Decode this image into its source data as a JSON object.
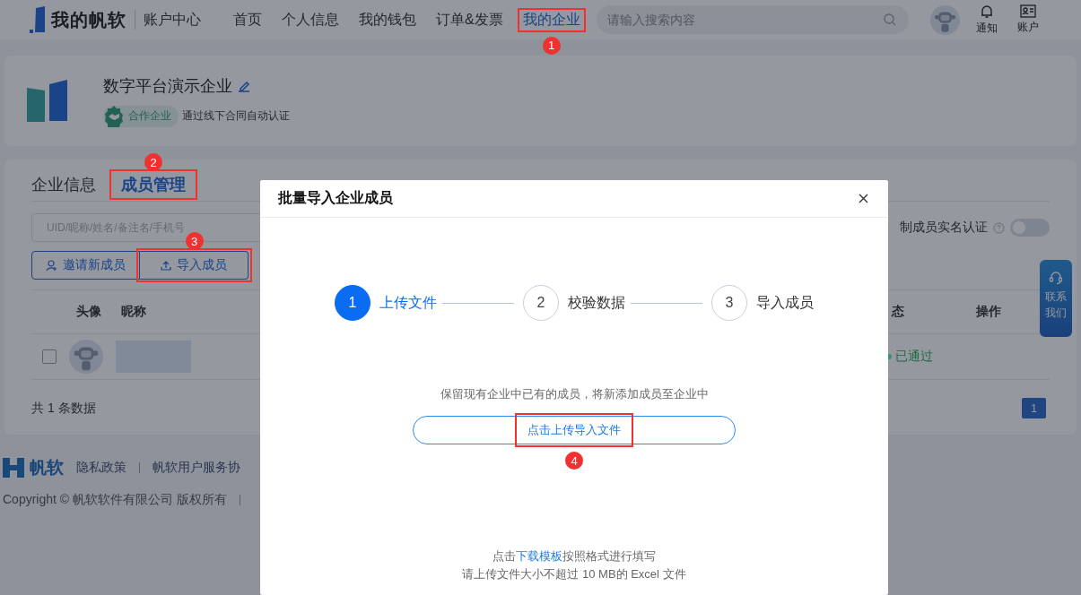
{
  "header": {
    "logo_text": "我的帆软",
    "section": "账户中心",
    "nav": [
      {
        "label": "首页",
        "selected": false
      },
      {
        "label": "个人信息",
        "selected": false
      },
      {
        "label": "我的钱包",
        "selected": false
      },
      {
        "label": "订单&发票",
        "selected": false
      },
      {
        "label": "我的企业",
        "selected": true,
        "callout": "1"
      }
    ],
    "search": {
      "placeholder": "请输入搜索内容"
    },
    "actions": [
      {
        "label": "通知",
        "kind": "bell"
      },
      {
        "label": "账户",
        "kind": "card"
      }
    ]
  },
  "company": {
    "name": "数字平台演示企业",
    "badge": "合作企业",
    "note": "通过线下合同自动认证"
  },
  "members": {
    "tabs": [
      {
        "label": "企业信息",
        "selected": false
      },
      {
        "label": "成员管理",
        "selected": true,
        "callout": "2"
      }
    ],
    "search": {
      "placeholder": "UID/昵称/姓名/备注名/手机号"
    },
    "toggle": {
      "label": "制成员实名认证",
      "on": false
    },
    "buttons": [
      {
        "label": "邀请新成员",
        "kind": "invite"
      },
      {
        "label": "导入成员",
        "kind": "import",
        "callout": "3"
      }
    ],
    "columns": [
      "头像",
      "昵称",
      "态",
      "操作"
    ],
    "rows": [
      {
        "checked": false,
        "status": "已通过",
        "color": "#3a8f7a"
      }
    ],
    "total": "共 1 条数据",
    "pages": [
      {
        "label": "1",
        "selected": true
      }
    ]
  },
  "contact": "联系我们",
  "footer": {
    "brand": "帆软",
    "links": [
      "隐私政策",
      "帆软用户服务协"
    ],
    "copyright": "Copyright © 帆软软件有限公司 版权所有"
  },
  "dialog": {
    "title": "批量导入企业成员",
    "steps": [
      {
        "number": "1",
        "label": "上传文件",
        "active": true
      },
      {
        "number": "2",
        "label": "校验数据",
        "active": false
      },
      {
        "number": "3",
        "label": "导入成员",
        "active": false
      }
    ],
    "hint": "保留现有企业中已有的成员，将新添加成员至企业中",
    "upload": {
      "label": "点击上传导入文件",
      "callout": "4"
    },
    "template": {
      "before": "点击",
      "link": "下载模板",
      "after": "按照格式进行填写"
    },
    "limit": "请上传文件大小不超过 10 MB的 Excel 文件"
  }
}
